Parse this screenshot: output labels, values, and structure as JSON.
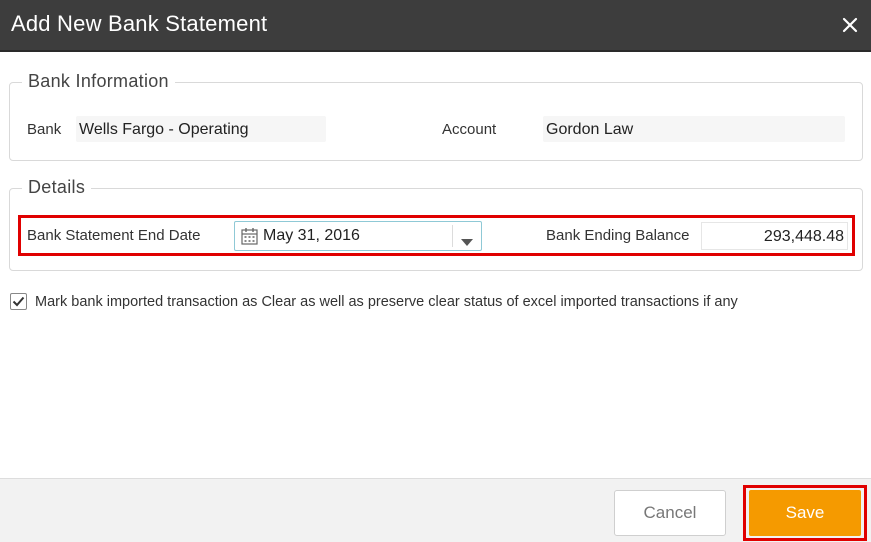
{
  "dialog": {
    "title": "Add New Bank Statement"
  },
  "bank_info": {
    "legend": "Bank Information",
    "bank_label": "Bank",
    "bank_value": "Wells Fargo - Operating",
    "account_label": "Account",
    "account_value": "Gordon Law"
  },
  "details": {
    "legend": "Details",
    "end_date_label": "Bank Statement End Date",
    "end_date_value": "May 31, 2016",
    "ending_balance_label": "Bank Ending Balance",
    "ending_balance_value": "293,448.48"
  },
  "options": {
    "mark_clear_checked": true,
    "mark_clear_label": "Mark bank imported transaction as Clear as well as preserve clear status of excel imported transactions if any"
  },
  "footer": {
    "cancel_label": "Cancel",
    "save_label": "Save"
  },
  "colors": {
    "titlebar_bg": "#3d3d3d",
    "save_button": "#f59a00",
    "highlight_outline": "#e00000"
  },
  "icons": {
    "close": "close-icon",
    "calendar": "calendar-icon",
    "dropdown": "chevron-down-icon",
    "checkmark": "checkmark-icon"
  }
}
